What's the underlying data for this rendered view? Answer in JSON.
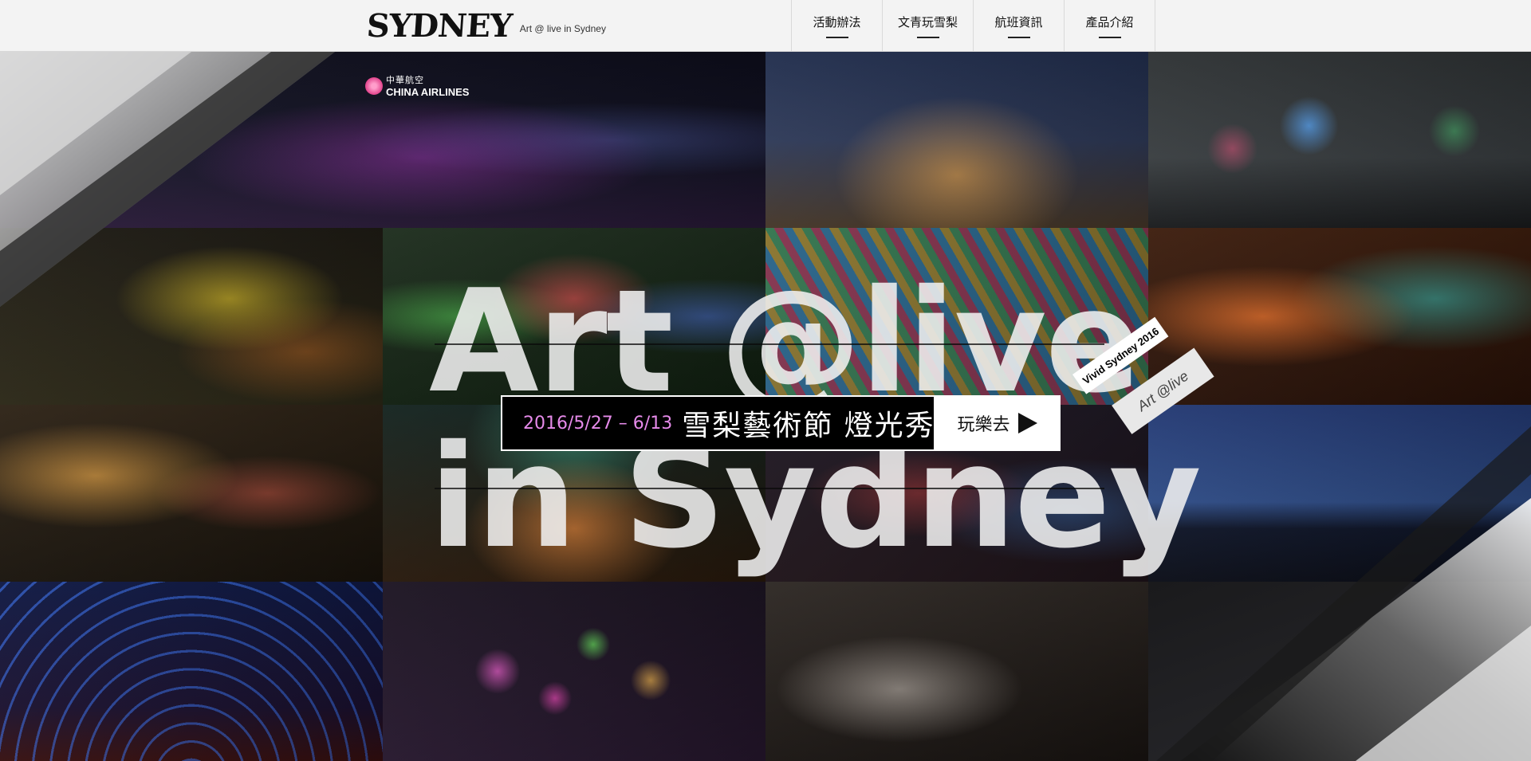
{
  "brand": {
    "logo_text": "SYDNEY",
    "tagline": "Art @ live in Sydney"
  },
  "nav": {
    "items": [
      {
        "label": "活動辦法"
      },
      {
        "label": "文青玩雪梨"
      },
      {
        "label": "航班資訊"
      },
      {
        "label": "產品介紹"
      }
    ]
  },
  "sponsor": {
    "name_zh": "中華航空",
    "name_en": "CHINA AIRLINES"
  },
  "hero": {
    "line1": "Art @live",
    "line2": "in Sydney"
  },
  "banner": {
    "date": "2016/5/27 – 6/13",
    "title": "雪梨藝術節 燈光秀",
    "cta_label": "玩樂去"
  },
  "ribbon": {
    "tag_top": "Vivid Sydney 2016",
    "tag_bottom": "Art @live"
  },
  "colors": {
    "accent_pink": "#e58ae9",
    "topbar_bg": "#f3f3f3"
  },
  "tiles": [
    {
      "name": "opera-house-glow-tile"
    },
    {
      "name": "customs-house-tile"
    },
    {
      "name": "clock-facade-tile"
    },
    {
      "name": "sunflower-projection-tile"
    },
    {
      "name": "colorful-building-tile"
    },
    {
      "name": "sails-pattern-tile"
    },
    {
      "name": "orange-projection-tile"
    },
    {
      "name": "arched-arcade-tile"
    },
    {
      "name": "tree-light-tile"
    },
    {
      "name": "harbour-bridge-tile"
    },
    {
      "name": "blue-tunnel-tile"
    },
    {
      "name": "bubble-sculpture-tile"
    },
    {
      "name": "dancer-tile"
    }
  ]
}
